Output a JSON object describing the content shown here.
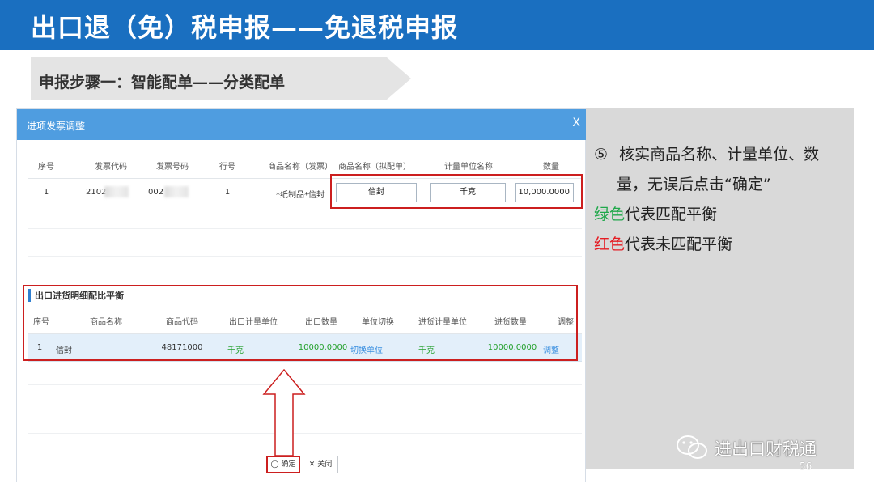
{
  "header": {
    "title": "出口退（免）税申报——免退税申报"
  },
  "step": {
    "label": "申报步骤一：智能配单——分类配单"
  },
  "dialog": {
    "title": "进项发票调整",
    "close_glyph": "X",
    "table1": {
      "headers": [
        "序号",
        "发票代码",
        "发票号码",
        "行号",
        "商品名称（发票）",
        "商品名称（拟配单）",
        "计量单位名称",
        "数量"
      ],
      "row": {
        "seq": "1",
        "invoice_code": "2102",
        "invoice_no": "002",
        "line_no": "1",
        "goods_invoice": "*纸制品*信封",
        "goods_match": "信封",
        "unit": "千克",
        "qty": "10,000.0000"
      }
    },
    "section2_title": "出口进货明细配比平衡",
    "table2": {
      "headers": [
        "序号",
        "商品名称",
        "商品代码",
        "出口计量单位",
        "出口数量",
        "单位切换",
        "进货计量单位",
        "进货数量",
        "调整"
      ],
      "row": {
        "seq": "1",
        "name": "信封",
        "code": "48171000",
        "export_unit": "千克",
        "export_qty": "10000.0000",
        "switch": "切换单位",
        "purchase_unit": "千克",
        "purchase_qty": "10000.0000",
        "adjust": "调整"
      }
    },
    "buttons": {
      "ok": "确定",
      "close": "关闭"
    }
  },
  "note": {
    "circled_num": "⑤",
    "line1": "核实商品名称、计量单位、数",
    "line2": "量，无误后点击“确定”",
    "green_prefix": "绿色",
    "green_rest": "代表匹配平衡",
    "red_prefix": "红色",
    "red_rest": "代表未匹配平衡"
  },
  "watermark": {
    "text": "进出口财税通"
  },
  "page_number": "56",
  "colors": {
    "banner": "#1a6fc0",
    "dialog_header": "#4f9de0",
    "highlight": "#cc1f1f",
    "green": "#23a02b",
    "red": "#e51c23"
  }
}
